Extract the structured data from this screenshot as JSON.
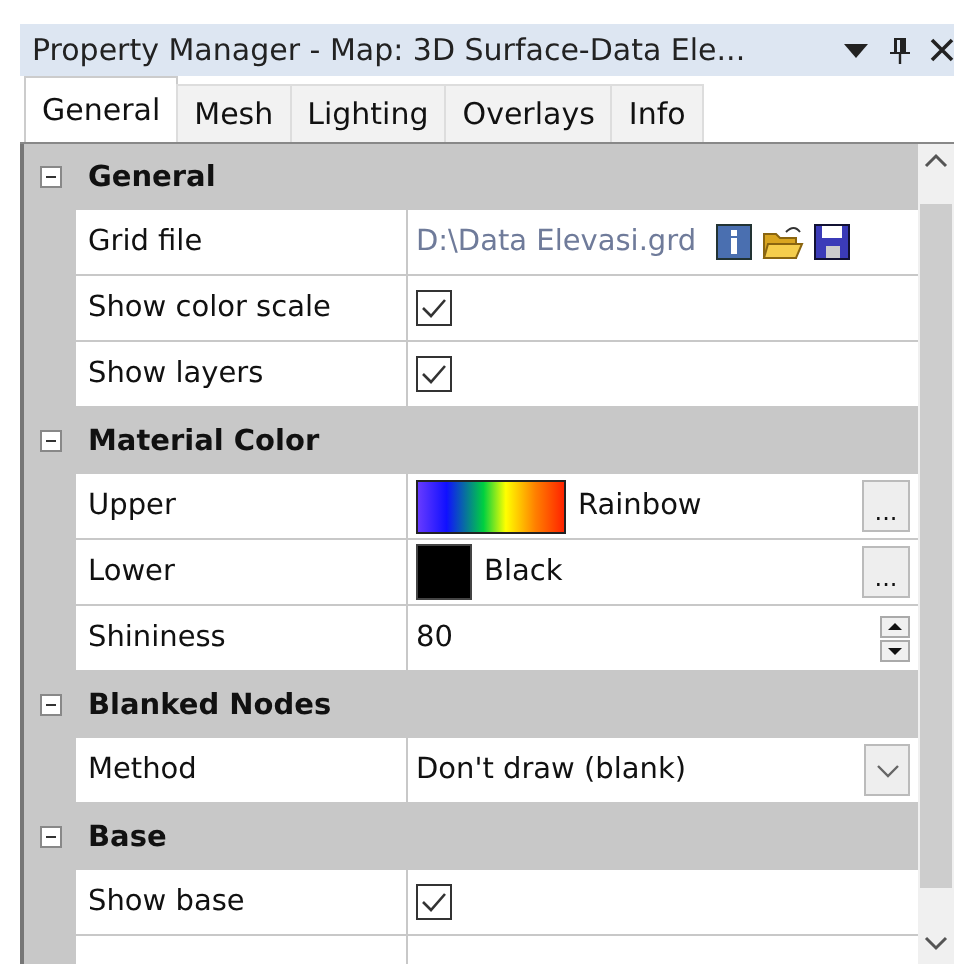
{
  "window": {
    "title": "Property Manager - Map: 3D Surface-Data Ele..."
  },
  "tabs": [
    {
      "label": "General",
      "selected": true
    },
    {
      "label": "Mesh",
      "selected": false
    },
    {
      "label": "Lighting",
      "selected": false
    },
    {
      "label": "Overlays",
      "selected": false
    },
    {
      "label": "Info",
      "selected": false
    }
  ],
  "sections": [
    {
      "name": "General",
      "expanded": true,
      "properties": [
        {
          "label": "Grid file",
          "kind": "file",
          "value": "D:\\Data Elevasi.grd"
        },
        {
          "label": "Show color scale",
          "kind": "checkbox",
          "checked": true
        },
        {
          "label": "Show layers",
          "kind": "checkbox",
          "checked": true
        }
      ]
    },
    {
      "name": "Material Color",
      "expanded": true,
      "properties": [
        {
          "label": "Upper",
          "kind": "gradient",
          "value": "Rainbow",
          "button_label": "..."
        },
        {
          "label": "Lower",
          "kind": "color",
          "color": "#000000",
          "value": "Black",
          "button_label": "..."
        },
        {
          "label": "Shininess",
          "kind": "spinner",
          "value": "80"
        }
      ]
    },
    {
      "name": "Blanked Nodes",
      "expanded": true,
      "properties": [
        {
          "label": "Method",
          "kind": "dropdown",
          "value": "Don't draw (blank)"
        }
      ]
    },
    {
      "name": "Base",
      "expanded": true,
      "properties": [
        {
          "label": "Show base",
          "kind": "checkbox",
          "checked": true
        },
        {
          "kind": "blank"
        }
      ]
    }
  ]
}
